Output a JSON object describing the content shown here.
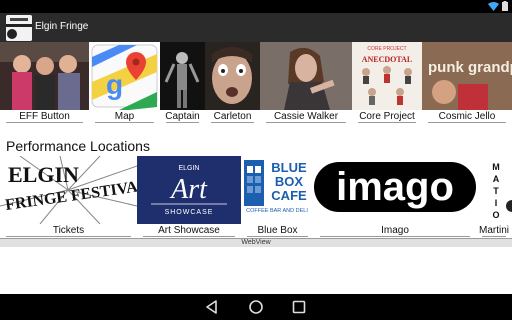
{
  "app": {
    "title": "Elgin Fringe"
  },
  "performers": [
    {
      "label": "EFF Button",
      "icon": "eff-button-photo"
    },
    {
      "label": "Map",
      "icon": "google-maps-icon"
    },
    {
      "label": "Captain",
      "icon": "captain-photo"
    },
    {
      "label": "Carleton",
      "icon": "carleton-photo"
    },
    {
      "label": "Cassie Walker",
      "icon": "cassie-walker-photo"
    },
    {
      "label": "Core Project",
      "icon": "core-project-poster"
    },
    {
      "label": "Cosmic Jello",
      "icon": "cosmic-jello-poster"
    }
  ],
  "section": {
    "title": "Performance Locations"
  },
  "locations": [
    {
      "label": "Tickets",
      "icon": "elgin-fringe-festival-logo"
    },
    {
      "label": "Art Showcase",
      "icon": "elgin-art-showcase-logo"
    },
    {
      "label": "Blue Box",
      "icon": "blue-box-cafe-logo"
    },
    {
      "label": "Imago",
      "icon": "imago-logo"
    },
    {
      "label": "Martini",
      "icon": "martini-logo"
    }
  ],
  "logos": {
    "eff": [
      "ELGIN",
      "FRINGE FESTIVAL"
    ],
    "art": [
      "ELGIN",
      "Art",
      "SHOWCASE"
    ],
    "bluebox": [
      "BLUE",
      "BOX",
      "CAFE",
      "COFFEE BAR AND DELI"
    ],
    "imago": "imago",
    "martini": [
      "M",
      "A",
      "T",
      "I",
      "O"
    ]
  },
  "webview": {
    "label": "WebView"
  },
  "colors": {
    "action_bar": "#2b2b2b",
    "blue_box": "#1c5fae",
    "art_showcase": "#1f2f6e"
  }
}
